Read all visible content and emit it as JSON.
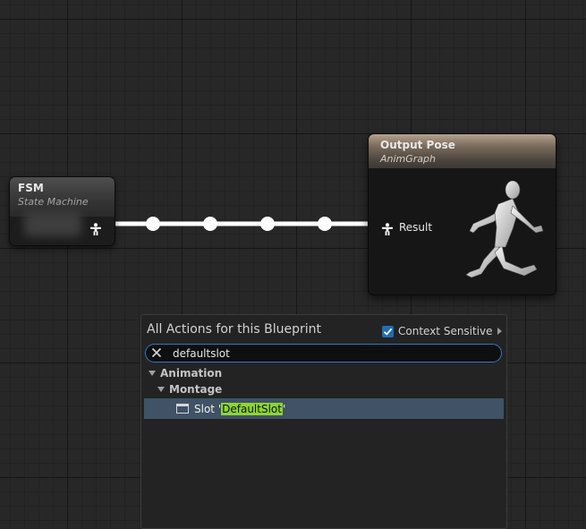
{
  "fsm_node": {
    "title": "FSM",
    "subtitle": "State Machine",
    "output_pin_icon": "pose-pin-icon"
  },
  "output_pose_node": {
    "title": "Output Pose",
    "subtitle": "AnimGraph",
    "input_pin_label": "Result",
    "input_pin_icon": "pose-pin-icon",
    "preview_icon": "running-mannequin-icon"
  },
  "wire": {
    "color": "#ffffff",
    "reroute_knots": 4
  },
  "action_menu": {
    "title": "All Actions for this Blueprint",
    "context_sensitive": {
      "label": "Context Sensitive",
      "checked": true
    },
    "search": {
      "value": "defaultslot",
      "clear_icon": "close-icon"
    },
    "tree": [
      {
        "label": "Animation",
        "expanded": true,
        "children": [
          {
            "label": "Montage",
            "expanded": true,
            "children": [
              {
                "label_prefix": "Slot '",
                "label_match": "DefaultSlot",
                "label_suffix": "'",
                "selected": true,
                "icon": "slot-node-icon"
              }
            ]
          }
        ]
      }
    ],
    "highlight_color": "#8bd62f",
    "selection_color": "#3f5266"
  }
}
